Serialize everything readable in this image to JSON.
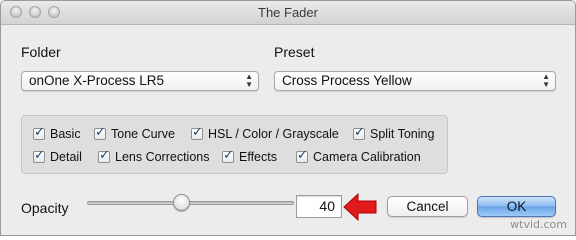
{
  "window": {
    "title": "The Fader"
  },
  "folder": {
    "label": "Folder",
    "selected": "onOne X-Process LR5"
  },
  "preset": {
    "label": "Preset",
    "selected": "Cross Process Yellow"
  },
  "options": [
    {
      "label": "Basic",
      "checked": true
    },
    {
      "label": "Tone Curve",
      "checked": true
    },
    {
      "label": "HSL / Color / Grayscale",
      "checked": true
    },
    {
      "label": "Split Toning",
      "checked": true
    },
    {
      "label": "Detail",
      "checked": true
    },
    {
      "label": "Lens Corrections",
      "checked": true
    },
    {
      "label": "Effects",
      "checked": true
    },
    {
      "label": "Camera Calibration",
      "checked": true
    }
  ],
  "opacity": {
    "label": "Opacity",
    "value": "40",
    "slider_fraction": 0.45
  },
  "buttons": {
    "cancel": "Cancel",
    "ok": "OK"
  },
  "annotation": {
    "arrow_color": "#e01b1b"
  },
  "watermark": "wtvid.com"
}
